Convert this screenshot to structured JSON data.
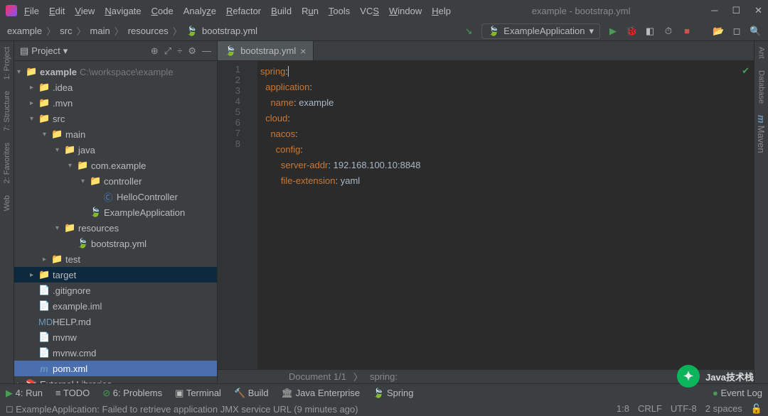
{
  "window": {
    "title": "example - bootstrap.yml"
  },
  "menu": [
    "File",
    "Edit",
    "View",
    "Navigate",
    "Code",
    "Analyze",
    "Refactor",
    "Build",
    "Run",
    "Tools",
    "VCS",
    "Window",
    "Help"
  ],
  "breadcrumb": [
    "example",
    "src",
    "main",
    "resources",
    "bootstrap.yml"
  ],
  "run_config": {
    "label": "ExampleApplication"
  },
  "left_tabs": [
    "1: Project",
    "7: Structure",
    "2: Favorites",
    "Web"
  ],
  "right_tabs": [
    "Ant",
    "Database",
    "Maven"
  ],
  "project_panel": {
    "title": "Project"
  },
  "tree": {
    "root": {
      "name": "example",
      "path": "C:\\workspace\\example"
    },
    "idea": ".idea",
    "mvn": ".mvn",
    "src": "src",
    "main": "main",
    "java": "java",
    "pkg": "com.example",
    "controller": "controller",
    "hello": "HelloController",
    "app": "ExampleApplication",
    "resources": "resources",
    "bootstrap": "bootstrap.yml",
    "test": "test",
    "target": "target",
    "gitignore": ".gitignore",
    "iml": "example.iml",
    "help": "HELP.md",
    "mvnw": "mvnw",
    "mvnwcmd": "mvnw.cmd",
    "pom": "pom.xml",
    "extlibs": "External Libraries"
  },
  "tab": {
    "name": "bootstrap.yml"
  },
  "code": {
    "l1": "spring:",
    "l2": "  application:",
    "l3": "    name: example",
    "l4": "  cloud:",
    "l5": "    nacos:",
    "l6": "      config:",
    "l7": "        server-addr: 192.168.100.10:8848",
    "l8": "        file-extension: yaml"
  },
  "editor_status": {
    "doc": "Document 1/1",
    "path": "spring:"
  },
  "bottom": {
    "run": "4: Run",
    "todo": "TODO",
    "problems": "6: Problems",
    "terminal": "Terminal",
    "build": "Build",
    "jee": "Java Enterprise",
    "spring": "Spring",
    "eventlog": "Event Log"
  },
  "status": {
    "msg": "ExampleApplication: Failed to retrieve application JMX service URL (9 minutes ago)",
    "pos": "1:8",
    "eol": "CRLF",
    "enc": "UTF-8",
    "indent": "2 spaces"
  },
  "watermark": "Java技术栈"
}
